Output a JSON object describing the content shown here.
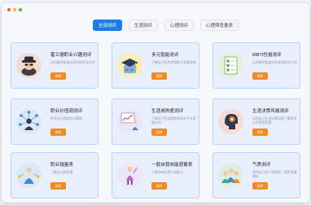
{
  "tabs": [
    {
      "label": "全部测评",
      "active": true
    },
    {
      "label": "生涯测评",
      "active": false
    },
    {
      "label": "心理测评",
      "active": false
    },
    {
      "label": "心理筛查量表",
      "active": false
    }
  ],
  "cards": [
    {
      "title": "霍兰德职业兴趣测评",
      "desc": "从问题的角度出发探索职业方向",
      "button": "测评",
      "icon": "detective-icon"
    },
    {
      "title": "多元智能测评",
      "desc": "了解自己的优势智能与发展领域",
      "button": "测评",
      "icon": "graduation-cap-icon"
    },
    {
      "title": "MBTI性格测评",
      "desc": "从性格的角度出发发现职业方向",
      "button": "测评",
      "icon": "checklist-icon"
    },
    {
      "title": "职业价值观测评",
      "desc": "探寻自己的职业价值观",
      "button": "测评",
      "icon": "network-person-icon"
    },
    {
      "title": "生涯成熟度测评",
      "desc": "了解自己生涯规划成熟水平与发展方向",
      "button": "测评",
      "icon": "presenter-chart-icon"
    },
    {
      "title": "生涯决策风格测评",
      "desc": "识别自己生涯决策风格了解科学认识规划风格",
      "button": "测评",
      "icon": "brain-icon"
    },
    {
      "title": "职业锚量表",
      "desc": "了解自己的职锚",
      "button": "测评",
      "icon": "anchor-person-icon"
    },
    {
      "title": "一般自我效能感量表",
      "desc": "了解你的自我行动能力",
      "button": "测评",
      "icon": "balloon-person-icon"
    },
    {
      "title": "气质测评",
      "desc": "测评自己的气质类型，提供发展建议",
      "button": "测评",
      "icon": "team-people-icon"
    }
  ],
  "colors": {
    "accent": "#1c7ce8",
    "button": "#f08a22",
    "card_bg": "#e9effd",
    "card_border": "#bcd4f4"
  }
}
